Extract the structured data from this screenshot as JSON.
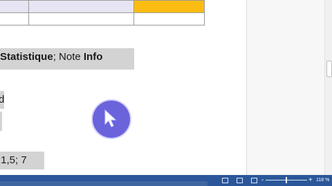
{
  "document": {
    "line1": {
      "part1": "Statistique",
      "part2": "; Note ",
      "part3": "Info"
    },
    "fragment2": "d",
    "line4": {
      "text": ",1,5; 7"
    }
  },
  "statusbar": {
    "zoom_minus": "-",
    "zoom_plus": "+",
    "zoom_level": "118 %"
  },
  "colors": {
    "table_header_lavender": "#e7e5f4",
    "table_header_orange": "#fbbd12",
    "highlight_gray": "#d3d3d3",
    "cursor_highlight": "#6b63dc",
    "statusbar_blue": "#2b579a"
  },
  "icons": {
    "cursor": "mouse-pointer-icon",
    "read_mode": "read-mode-icon",
    "print_layout": "print-layout-icon",
    "web_layout": "web-layout-icon"
  }
}
